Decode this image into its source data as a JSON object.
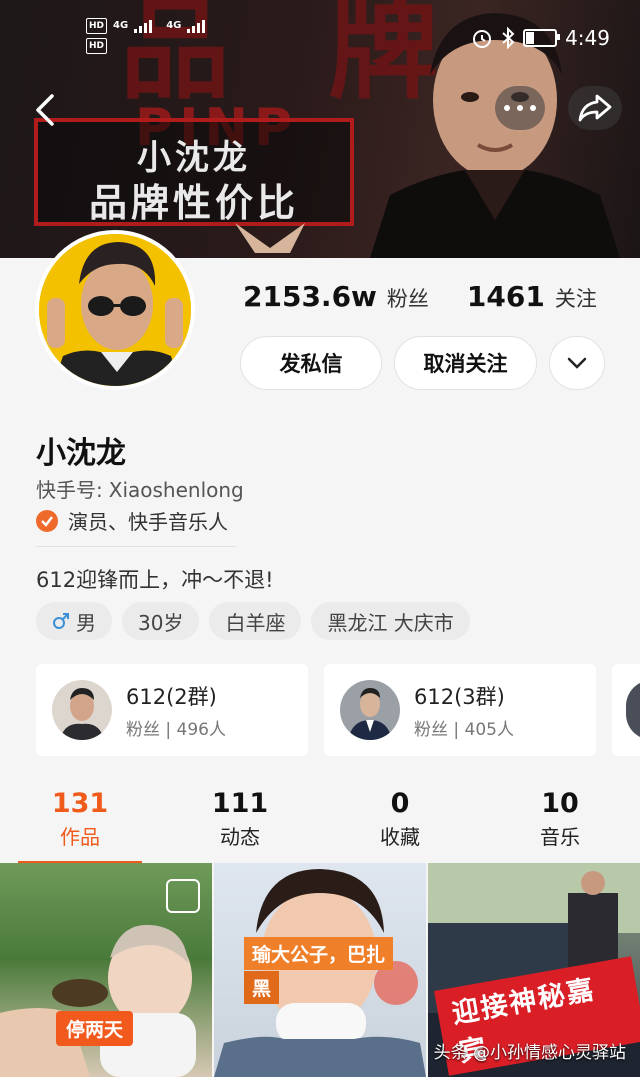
{
  "status_bar": {
    "hd1": "HD",
    "net1": "4G",
    "hd2": "HD",
    "net2": "4G",
    "time": "4:49",
    "battery_level": 0.25
  },
  "banner": {
    "line1": "小沈龙",
    "line2": "品牌性价比",
    "bg_text": "PINP"
  },
  "profile": {
    "stats": [
      {
        "num": "2153.6w",
        "label": "粉丝"
      },
      {
        "num": "1461",
        "label": "关注"
      }
    ],
    "buttons": {
      "message": "发私信",
      "unfollow": "取消关注"
    },
    "name": "小沈龙",
    "kuaishou_id_label": "快手号:",
    "kuaishou_id": "Xiaoshenlong",
    "verification": "演员、快手音乐人",
    "bio": "612迎锋而上，冲～不退!",
    "tags": [
      {
        "label": "男",
        "icon": "male-icon"
      },
      {
        "label": "30岁"
      },
      {
        "label": "白羊座"
      },
      {
        "label": "黑龙江 大庆市"
      }
    ]
  },
  "groups": [
    {
      "name": "612(2群)",
      "sub": "粉丝 | 496人"
    },
    {
      "name": "612(3群)",
      "sub": "粉丝 | 405人"
    }
  ],
  "tabs": [
    {
      "num": "131",
      "label": "作品"
    },
    {
      "num": "111",
      "label": "动态"
    },
    {
      "num": "0",
      "label": "收藏"
    },
    {
      "num": "10",
      "label": "音乐"
    }
  ],
  "grid": {
    "item1_caption": "停两天",
    "item2_caption_a": "瑜大公子，巴扎",
    "item2_caption_b": "黑",
    "item3_caption": "迎接神秘嘉宾",
    "watermark": "头条 @小孙情感心灵驿站"
  },
  "colors": {
    "accent": "#f05a1a",
    "banner_red": "#b01c1c"
  }
}
